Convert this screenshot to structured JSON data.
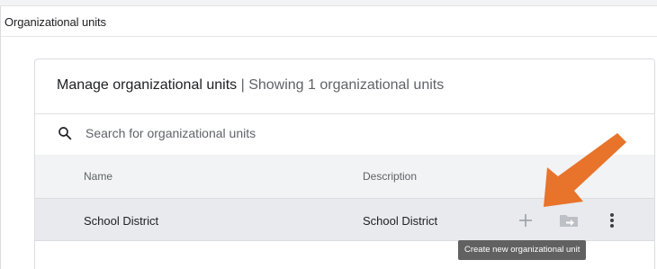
{
  "page": {
    "title": "Organizational units"
  },
  "card": {
    "title_bold": "Manage organizational units",
    "title_separator": " | ",
    "title_count": "Showing 1 organizational units"
  },
  "search": {
    "placeholder": "Search for organizational units",
    "value": "",
    "icon": "search-icon"
  },
  "table": {
    "columns": [
      "Name",
      "Description"
    ],
    "rows": [
      {
        "name": "School District",
        "description": "School District"
      }
    ],
    "row_actions": [
      "add-icon",
      "move-folder-icon",
      "more-vert-icon"
    ]
  },
  "tooltip": {
    "text": "Create new organizational unit"
  },
  "colors": {
    "accent_arrow": "#e8732a",
    "header_bg": "#f1f3f4",
    "row_hover_bg": "#e8eaed",
    "tooltip_bg": "#616161"
  }
}
